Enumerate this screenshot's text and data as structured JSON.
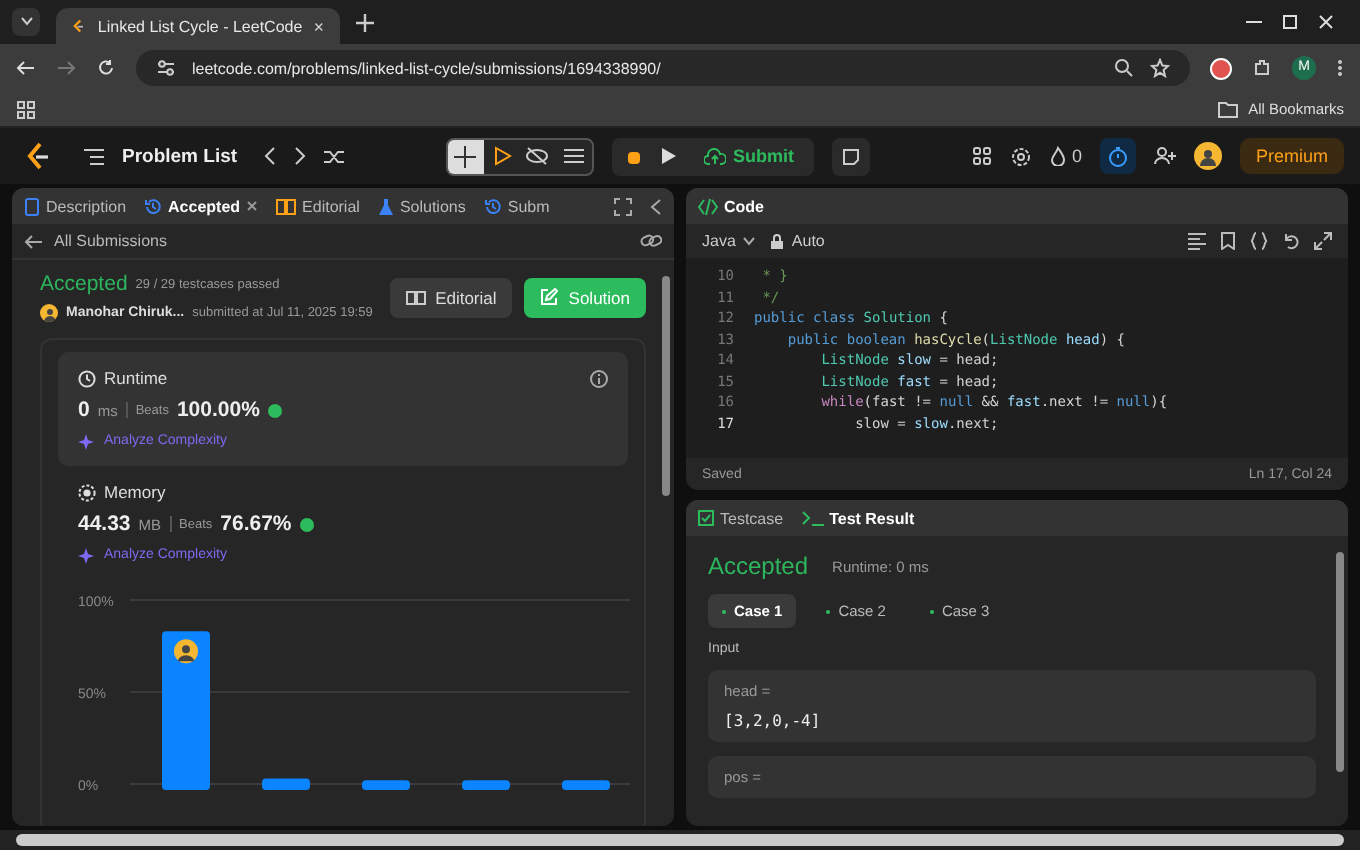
{
  "browser": {
    "tabs": [
      {
        "title": "Linked List Cycle - LeetCode",
        "selected": true
      }
    ],
    "address": "leetcode.com/problems/linked-list-cycle/submissions/1694338990/",
    "profile": "M",
    "bookmarks_label": "All Bookmarks"
  },
  "nav": {
    "problem_list": "Problem List",
    "submit": "Submit",
    "streak": "0",
    "premium": "Premium"
  },
  "left": {
    "tabs": [
      {
        "label": "Description",
        "kind": "doc",
        "selected": false
      },
      {
        "label": "Accepted",
        "kind": "history",
        "selected": true
      },
      {
        "label": "Editorial",
        "kind": "book",
        "selected": false
      },
      {
        "label": "Solutions",
        "kind": "flask",
        "selected": false
      },
      {
        "label": "Subm",
        "kind": "history",
        "selected": false
      }
    ],
    "back": "All Submissions",
    "status": "Accepted",
    "tests": "29 / 29 testcases passed",
    "author": "Manohar Chiruk...",
    "submitted": "submitted at Jul 11, 2025 19:59",
    "buttons": [
      {
        "label": "Editorial",
        "kind": "secondary"
      },
      {
        "label": "Solution",
        "kind": "primary"
      }
    ],
    "metrics": [
      {
        "title": "Runtime",
        "kind": "clock",
        "value": "0",
        "unit": "ms",
        "beats_label": "Beats",
        "beats": "100.00%",
        "analyze": "Analyze Complexity"
      },
      {
        "title": "Memory",
        "kind": "chip",
        "value": "44.33",
        "unit": "MB",
        "beats_label": "Beats",
        "beats": "76.67%",
        "analyze": "Analyze Complexity"
      }
    ],
    "chart_data": {
      "type": "bar",
      "values": [
        83,
        3,
        2,
        2,
        2
      ],
      "ylim": [
        0,
        100
      ],
      "yticks": [
        {
          "value": 0,
          "label": "0%"
        },
        {
          "value": 50,
          "label": "50%"
        },
        {
          "value": 100,
          "label": "100%"
        }
      ]
    }
  },
  "right": {
    "title": "Code",
    "language": "Java",
    "mode": "Auto",
    "lines": [
      {
        "number": "10",
        "current": false,
        "tokens": [
          {
            "t": " * }",
            "color": "#6a9955"
          }
        ]
      },
      {
        "number": "11",
        "current": false,
        "tokens": [
          {
            "t": " */",
            "color": "#6a9955"
          }
        ]
      },
      {
        "number": "12",
        "current": false,
        "tokens": [
          {
            "t": "public class ",
            "color": "#569cd6"
          },
          {
            "t": "Solution",
            "color": "#4ec9b0"
          },
          {
            "t": " {",
            "color": "#d4d4d4"
          }
        ]
      },
      {
        "number": "13",
        "current": false,
        "tokens": [
          {
            "t": "    public boolean ",
            "color": "#569cd6"
          },
          {
            "t": "hasCycle",
            "color": "#dcdcaa"
          },
          {
            "t": "(",
            "color": "#d4d4d4"
          },
          {
            "t": "ListNode ",
            "color": "#4ec9b0"
          },
          {
            "t": "head",
            "color": "#9cdcfe"
          },
          {
            "t": ") {",
            "color": "#d4d4d4"
          }
        ]
      },
      {
        "number": "14",
        "current": false,
        "tokens": [
          {
            "t": "        ListNode ",
            "color": "#4ec9b0"
          },
          {
            "t": "slow",
            "color": "#9cdcfe"
          },
          {
            "t": " = head;",
            "color": "#d4d4d4"
          }
        ]
      },
      {
        "number": "15",
        "current": false,
        "tokens": [
          {
            "t": "        ListNode ",
            "color": "#4ec9b0"
          },
          {
            "t": "fast",
            "color": "#9cdcfe"
          },
          {
            "t": " = head;",
            "color": "#d4d4d4"
          }
        ]
      },
      {
        "number": "16",
        "current": false,
        "tokens": [
          {
            "t": "        while",
            "color": "#c586c0"
          },
          {
            "t": "(fast != ",
            "color": "#d4d4d4"
          },
          {
            "t": "null",
            "color": "#569cd6"
          },
          {
            "t": " && ",
            "color": "#d4d4d4"
          },
          {
            "t": "fast",
            "color": "#9cdcfe"
          },
          {
            "t": ".next != ",
            "color": "#d4d4d4"
          },
          {
            "t": "null",
            "color": "#569cd6"
          },
          {
            "t": "){",
            "color": "#d4d4d4"
          }
        ]
      },
      {
        "number": "17",
        "current": true,
        "tokens": [
          {
            "t": "            slow = ",
            "color": "#d4d4d4"
          },
          {
            "t": "slow",
            "color": "#9cdcfe"
          },
          {
            "t": ".next;",
            "color": "#d4d4d4"
          }
        ]
      }
    ],
    "status": "Saved",
    "position": "Ln 17, Col 24"
  },
  "test": {
    "tabs": [
      {
        "label": "Testcase",
        "selected": false
      },
      {
        "label": "Test Result",
        "selected": true
      }
    ],
    "result": "Accepted",
    "runtime": "Runtime: 0 ms",
    "cases": [
      {
        "label": "Case 1",
        "selected": true
      },
      {
        "label": "Case 2",
        "selected": false
      },
      {
        "label": "Case 3",
        "selected": false
      }
    ],
    "input_label": "Input",
    "inputs": [
      {
        "name": "head =",
        "value": "[3,2,0,-4]"
      },
      {
        "name": "pos ="
      }
    ]
  }
}
